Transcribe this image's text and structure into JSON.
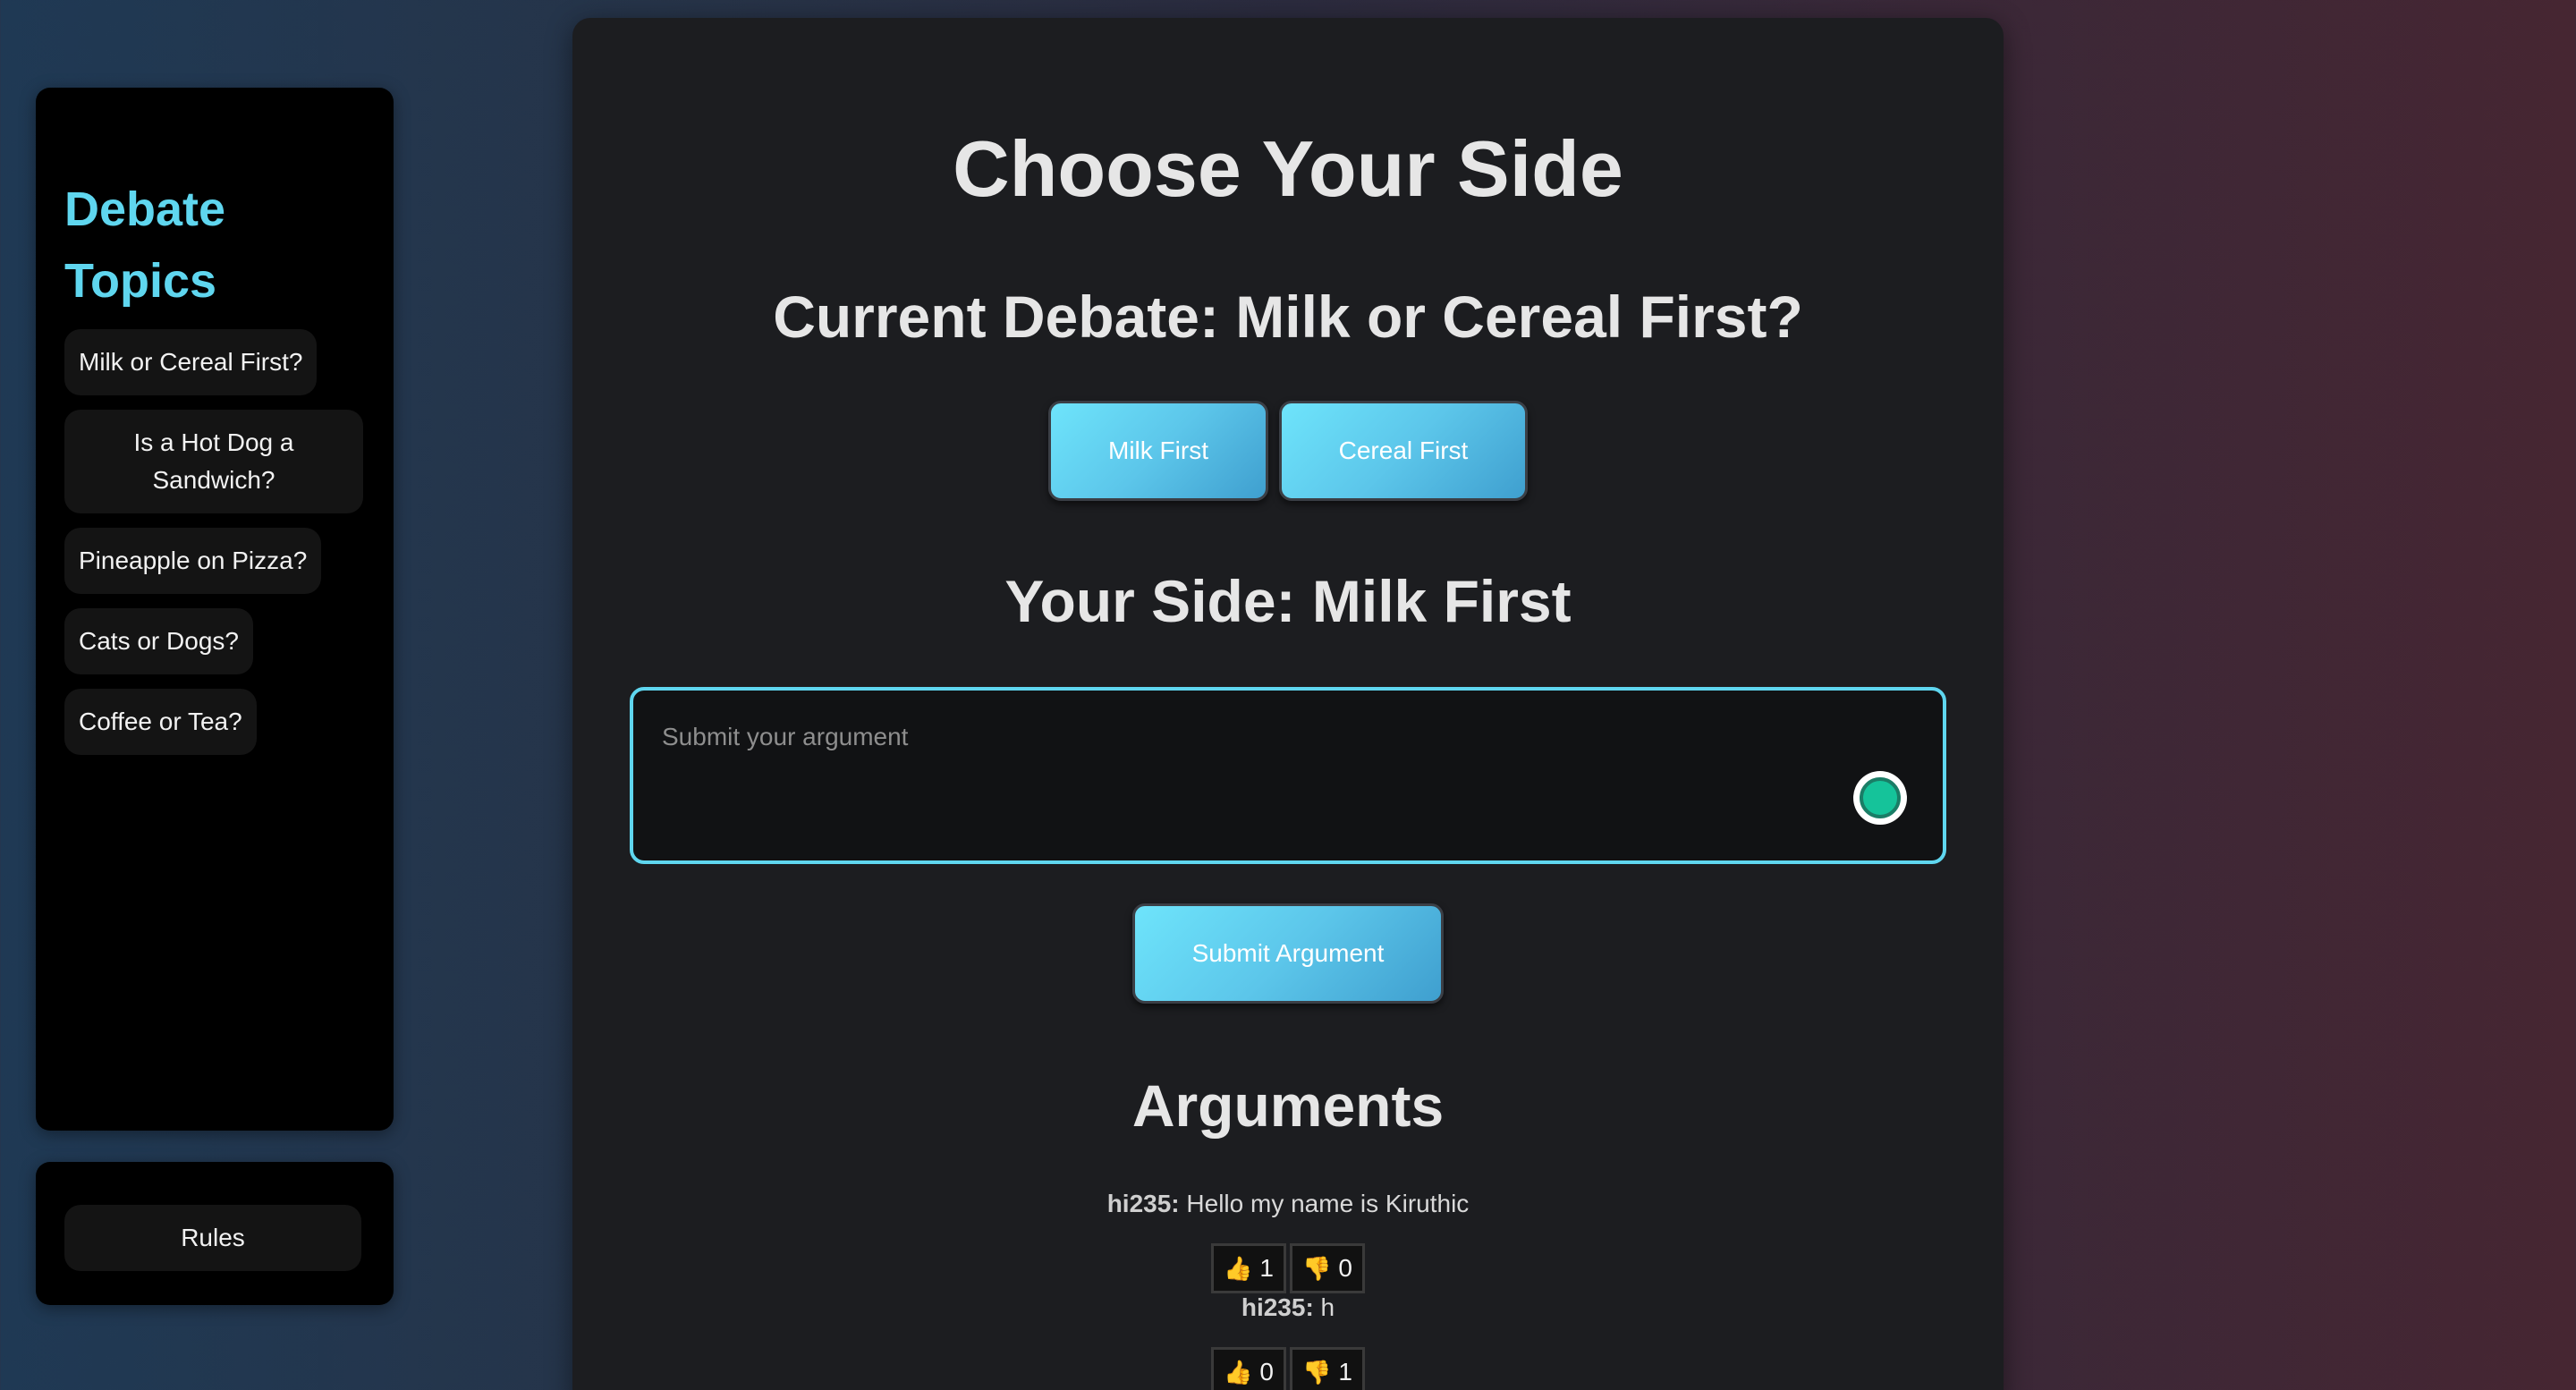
{
  "sidebar": {
    "title": "Debate Topics",
    "topics": [
      {
        "label": "Milk or Cereal First?"
      },
      {
        "label": "Is a Hot Dog a Sandwich?"
      },
      {
        "label": "Pineapple on Pizza?"
      },
      {
        "label": "Cats or Dogs?"
      },
      {
        "label": "Coffee or Tea?"
      }
    ],
    "rules_label": "Rules"
  },
  "main": {
    "title": "Choose Your Side",
    "current_debate": "Current Debate: Milk or Cereal First?",
    "side_buttons": {
      "milk": "Milk First",
      "cereal": "Cereal First"
    },
    "your_side": "Your Side: Milk First",
    "argument_input": {
      "placeholder": "Submit your argument",
      "value": ""
    },
    "submit_label": "Submit Argument",
    "arguments_heading": "Arguments",
    "arguments": [
      {
        "author": "hi235:",
        "text": " Hello my name is Kiruthic",
        "thumbs_up": "1",
        "thumbs_down": "0"
      },
      {
        "author": "hi235:",
        "text": " h",
        "thumbs_up": "0",
        "thumbs_down": "1"
      }
    ]
  },
  "icons": {
    "thumbs_up": "👍",
    "thumbs_down": "👎",
    "grammarly": "grammarly-icon"
  },
  "colors": {
    "accent": "#5fd6ef",
    "panel": "#1c1d20",
    "button_gradient_start": "#6ee4fb",
    "button_gradient_end": "#3f9fcf"
  }
}
